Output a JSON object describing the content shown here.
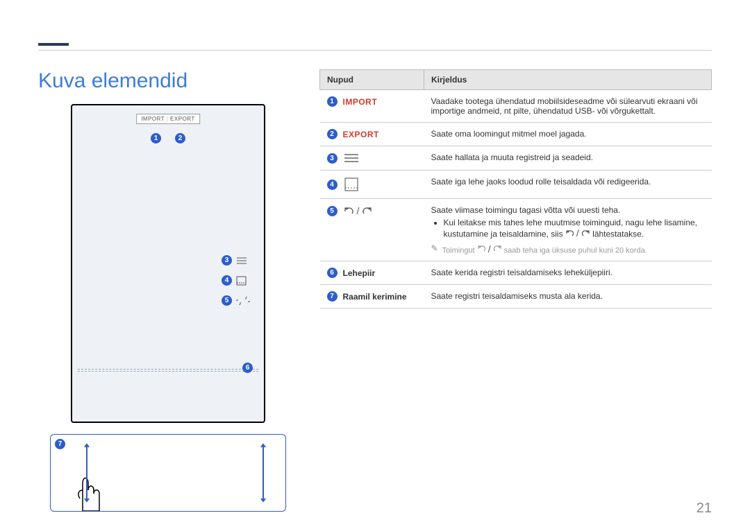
{
  "title": "Kuva elemendid",
  "topbar": {
    "import": "IMPORT",
    "export": "EXPORT"
  },
  "table": {
    "header_buttons": "Nupud",
    "header_desc": "Kirjeldus",
    "rows": {
      "r1": {
        "label": "IMPORT",
        "desc": "Vaadake tootega ühendatud mobiilsideseadme või sülearvuti ekraani või importige andmeid, nt pilte, ühendatud USB- või võrgukettalt."
      },
      "r2": {
        "label": "EXPORT",
        "desc": "Saate oma loomingut mitmel moel jagada."
      },
      "r3": {
        "desc": "Saate hallata ja muuta registreid ja seadeid."
      },
      "r4": {
        "desc": "Saate iga lehe jaoks loodud rolle teisaldada või redigeerida."
      },
      "r5": {
        "desc_line1": "Saate viimase toimingu tagasi võtta või uuesti teha.",
        "bullet1a": "Kui leitakse mis tahes lehe muutmise toiminguid, nagu lehe lisamine, kustutamine ja teisaldamine, siis ",
        "bullet1b": " lähtestatakse.",
        "note_a": "Toimingut ",
        "note_b": " saab teha iga üksuse puhul kuni 20 korda."
      },
      "r6": {
        "label": "Lehepiir",
        "desc": "Saate kerida registri teisaldamiseks leheküljepiiri."
      },
      "r7": {
        "label": "Raamil kerimine",
        "desc": "Saate registri teisaldamiseks musta ala kerida."
      }
    }
  },
  "digits": {
    "1": "1",
    "2": "2",
    "3": "3",
    "4": "4",
    "5": "5",
    "6": "6",
    "7": "7"
  },
  "page_number": "21"
}
